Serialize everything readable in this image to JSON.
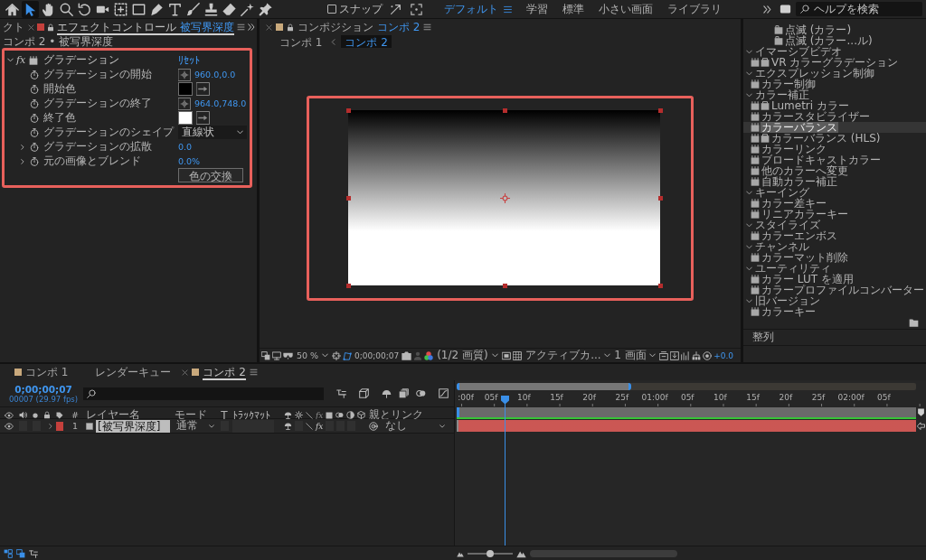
{
  "toolbar": {
    "tools": [
      {
        "selected": false
      },
      {
        "selected": true
      },
      {
        "selected": false
      },
      {
        "selected": false
      },
      {
        "selected": false
      },
      {
        "selected": false
      },
      {
        "selected": false
      },
      {
        "selected": false
      },
      {
        "selected": false
      },
      {
        "selected": false
      },
      {
        "selected": false
      },
      {
        "selected": false
      },
      {
        "selected": false
      },
      {
        "selected": false
      },
      {
        "selected": false
      }
    ],
    "snap": {
      "label": "スナップ",
      "checked": false
    },
    "workspaces": [
      {
        "label": "デフォルト",
        "selected": true
      },
      {
        "label": "学習",
        "selected": false
      },
      {
        "label": "標準",
        "selected": false
      },
      {
        "label": "小さい画面",
        "selected": false
      },
      {
        "label": "ライブラリ",
        "selected": false
      }
    ],
    "help_search": {
      "placeholder": "ヘルプを検索"
    }
  },
  "effect_controls": {
    "tabs": [
      {
        "label": "クト",
        "selected": false
      },
      {
        "label": "エフェクトコントロール",
        "layer": "被写界深度",
        "selected": true
      }
    ],
    "breadcrumb": "コンポ 2 • 被写界深度",
    "highlighted": true,
    "effect": {
      "toggle": "fx",
      "name": "グラデーション",
      "reset": "ﾘｾｯﾄ",
      "expanded": true,
      "properties": [
        {
          "kind": "point",
          "name": "グラデーションの開始",
          "value": "960.0,0.0"
        },
        {
          "kind": "color",
          "name": "開始色",
          "color": "#000000"
        },
        {
          "kind": "point",
          "name": "グラデーションの終了",
          "value": "964.0,748.0"
        },
        {
          "kind": "color",
          "name": "終了色",
          "color": "#ffffff"
        },
        {
          "kind": "menu",
          "name": "グラデーションのシェイプ",
          "value": "直線状"
        },
        {
          "kind": "number",
          "name": "グラデーションの拡散",
          "value": "0.0",
          "expanded": false
        },
        {
          "kind": "number",
          "name": "元の画像とブレンド",
          "value": "0.0%",
          "expanded": false
        },
        {
          "kind": "button",
          "label": "色の交換"
        }
      ]
    }
  },
  "composition": {
    "tab": {
      "label": "コンポジション",
      "comp": "コンポ 2"
    },
    "breadcrumbs": [
      {
        "label": "コンポ 1",
        "selected": false
      },
      {
        "label": "コンポ 2",
        "selected": true
      }
    ],
    "highlighted": true,
    "footer": {
      "zoom": "50 %",
      "timecode": "0;00;00;07",
      "resolution": "(1/2 画質)",
      "camera": "アクティブカ...",
      "views": "1 画面",
      "exposure": "+0.0"
    }
  },
  "effects_presets": {
    "tree": [
      {
        "children": [
          {
            "children": [
              {
                "kind": "preset",
                "label": "点滅 (カラー)",
                "selected": false
              },
              {
                "kind": "preset",
                "label": "点滅 (カラー...ル)",
                "selected": false
              }
            ]
          }
        ]
      },
      {
        "label": "イマーシブビデオ",
        "expanded": true,
        "children": [
          {
            "kind": "effect",
            "label": "VR カラーグラデーション",
            "gpu": true,
            "selected": false
          }
        ]
      },
      {
        "label": "エクスプレッション制御",
        "expanded": true,
        "children": [
          {
            "kind": "effect",
            "label": "カラー制御",
            "gpu": false,
            "selected": false
          }
        ]
      },
      {
        "label": "カラー補正",
        "expanded": true,
        "children": [
          {
            "kind": "effect",
            "label": "Lumetri カラー",
            "gpu": true,
            "selected": false
          },
          {
            "kind": "effect",
            "label": "カラースタビライザー",
            "gpu": false,
            "selected": false
          },
          {
            "kind": "effect",
            "label": "カラーバランス",
            "gpu": false,
            "selected": true
          },
          {
            "kind": "effect",
            "label": "カラーバランス (HLS)",
            "gpu": true,
            "selected": false
          },
          {
            "kind": "effect",
            "label": "カラーリンク",
            "gpu": false,
            "selected": false
          },
          {
            "kind": "effect",
            "label": "ブロードキャストカラー",
            "gpu": false,
            "selected": false
          },
          {
            "kind": "effect",
            "label": "他のカラーへ変更",
            "gpu": false,
            "selected": false
          },
          {
            "kind": "effect",
            "label": "自動カラー補正",
            "gpu": false,
            "selected": false
          }
        ]
      },
      {
        "label": "キーイング",
        "expanded": true,
        "children": [
          {
            "kind": "effect",
            "label": "カラー差キー",
            "gpu": false,
            "selected": false
          },
          {
            "kind": "effect",
            "label": "リニアカラーキー",
            "gpu": false,
            "selected": false
          }
        ]
      },
      {
        "label": "スタイライズ",
        "expanded": true,
        "children": [
          {
            "kind": "effect",
            "label": "カラーエンボス",
            "gpu": false,
            "selected": false
          }
        ]
      },
      {
        "label": "チャンネル",
        "expanded": true,
        "children": [
          {
            "kind": "effect",
            "label": "カラーマット削除",
            "gpu": false,
            "selected": false
          }
        ]
      },
      {
        "label": "ユーティリティ",
        "expanded": true,
        "children": [
          {
            "kind": "effect",
            "label": "カラー LUT を適用",
            "gpu": false,
            "selected": false
          },
          {
            "kind": "effect",
            "label": "カラープロファイルコンバーター",
            "gpu": false,
            "selected": false
          }
        ]
      },
      {
        "label": "旧バージョン",
        "expanded": true,
        "children": [
          {
            "kind": "effect",
            "label": "カラーキー",
            "gpu": false,
            "selected": false
          }
        ]
      }
    ],
    "next_panel": "整列"
  },
  "timeline": {
    "tabs": [
      {
        "kind": "composition",
        "label": "コンポ 1",
        "selected": false
      },
      {
        "kind": "render_queue",
        "label": "レンダーキュー",
        "selected": false
      },
      {
        "kind": "composition",
        "label": "コンポ 2",
        "selected": true
      }
    ],
    "timecode": "0;00;00;07",
    "frame_info": "00007 (29.97 fps)",
    "header": {
      "number": "#",
      "name": "レイヤー名",
      "mode": "モード",
      "t": "T",
      "matte": "ﾄﾗｯｸﾏｯﾄ",
      "fx": "fx",
      "parent": "親とリンク"
    },
    "layers": [
      {
        "visible": true,
        "expanded": false,
        "color": "#c4403c",
        "number": "1",
        "name": "[被写界深度]",
        "mode": "通常",
        "effect_switch": {
          "label": "fx",
          "on": true
        },
        "parent": "なし"
      }
    ],
    "ruler": [
      ":00f",
      "05f",
      "10f",
      "15f",
      "20f",
      "25f",
      "01:00f",
      "05f",
      "10f",
      "15f",
      "20f",
      "25f",
      "02:00f",
      "05f"
    ],
    "navigator": {
      "level": 0.38
    },
    "playhead": {
      "level": 0.105
    },
    "zoom_slider": {
      "level": 0.5
    }
  }
}
